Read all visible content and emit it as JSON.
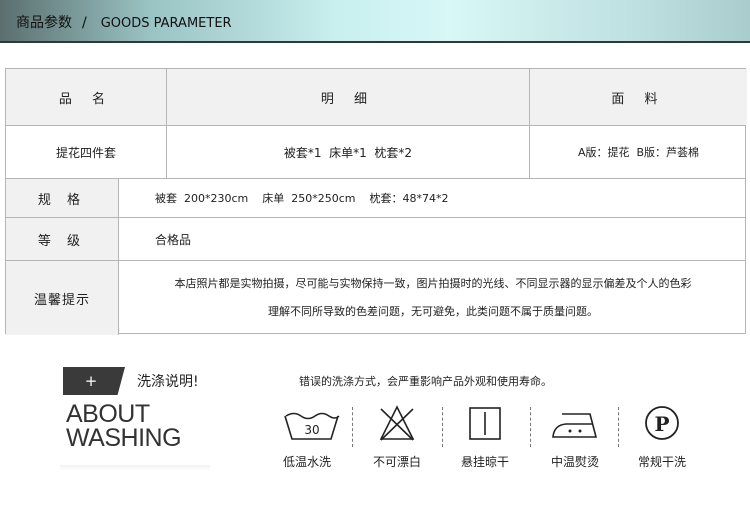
{
  "banner": {
    "cn": "商品参数",
    "sep": "/",
    "en": "GOODS PARAMETER"
  },
  "table": {
    "headers": {
      "name": "品 名",
      "detail": "明 细",
      "fabric": "面 料"
    },
    "product": {
      "name": "提花四件套",
      "detail": "被套*1  床单*1  枕套*2",
      "fabric": "A版：提花  B版：芦荟棉"
    },
    "spec": {
      "label": "规 格",
      "value": "被套  200*230cm    床单  250*250cm    枕套：48*74*2"
    },
    "grade": {
      "label": "等 级",
      "value": "合格品"
    },
    "tip": {
      "label": "温馨提示",
      "line1": "本店照片都是实物拍摄，尽可能与实物保持一致，图片拍摄时的光线、不同显示器的显示偏差及个人的色彩",
      "line2": "理解不同所导致的色差问题，无可避免，此类问题不属于质量问题。"
    }
  },
  "washing": {
    "plus": "+",
    "title": "洗涤说明!",
    "about1": "ABOUT",
    "about2": "WASHING",
    "warning": "错误的洗涤方式，会严重影响产品外观和使用寿命。",
    "icons": [
      {
        "name": "wash-30-icon",
        "label": "低温水洗",
        "text": "30"
      },
      {
        "name": "no-bleach-icon",
        "label": "不可漂白"
      },
      {
        "name": "hang-dry-icon",
        "label": "悬挂晾干"
      },
      {
        "name": "iron-medium-icon",
        "label": "中温熨烫"
      },
      {
        "name": "dry-clean-p-icon",
        "label": "常规干洗",
        "text": "P"
      }
    ]
  }
}
